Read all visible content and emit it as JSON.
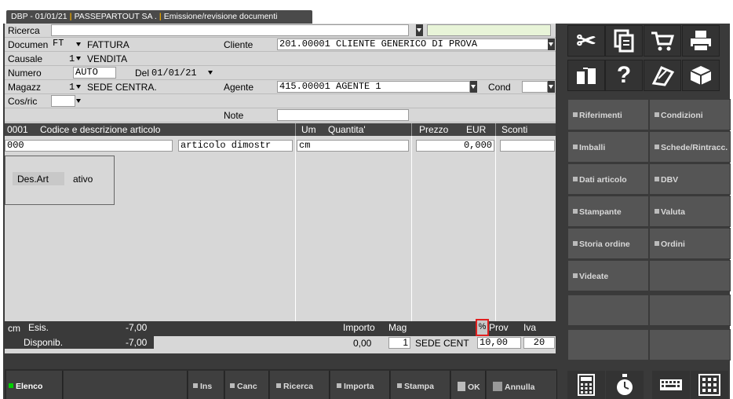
{
  "title_tab": {
    "part1": "DBP - 01/01/21",
    "part2": "PASSEPARTOUT SA .",
    "part3": "Emissione/revisione documenti"
  },
  "form": {
    "ricerca_label": "Ricerca",
    "documento_label": "Documen",
    "documento_code": "FT",
    "documento_desc": "FATTURA",
    "cliente_label": "Cliente",
    "cliente_value": "201.00001 CLIENTE GENERICO DI PROVA",
    "causale_label": "Causale",
    "causale_code": "1",
    "causale_desc": "VENDITA",
    "numero_label": "Numero",
    "numero_value": "AUTO",
    "del_label": "Del",
    "del_value": "01/01/21",
    "magazz_label": "Magazz",
    "magazz_code": "1",
    "magazz_desc": "SEDE CENTRA.",
    "agente_label": "Agente",
    "agente_value": "415.00001 AGENTE 1",
    "cond_label": "Cond",
    "cosric_label": "Cos/ric",
    "note_label": "Note"
  },
  "grid": {
    "headers": {
      "code": "0001",
      "desc": "Codice e descrizione articolo",
      "um": "Um",
      "qty": "Quantita'",
      "price": "Prezzo",
      "currency": "EUR",
      "discounts": "Sconti"
    },
    "row": {
      "code": "000",
      "desc": "articolo dimostr",
      "um": "cm",
      "price": "0,000"
    }
  },
  "popup": {
    "label": "Des.Art",
    "value": "ativo"
  },
  "status": {
    "um": "cm",
    "esis_label": "Esis.",
    "esis_value": "-7,00",
    "importo_label": "Importo",
    "mag_label": "Mag",
    "percent": "%",
    "prov_label": "Prov",
    "iva_label": "Iva",
    "disp_label": "Disponib.",
    "disp_value": "-7,00",
    "importo_value": "0,00",
    "mag_value": "1",
    "mag_desc": "SEDE CENT",
    "prov_value": "10,00",
    "iva_value": "20"
  },
  "toolbar": {
    "elenco": "Elenco",
    "ins": "Ins",
    "canc": "Canc",
    "ricerca": "Ricerca",
    "importa": "Importa",
    "stampa": "Stampa",
    "ok": "OK",
    "annulla": "Annulla"
  },
  "side_buttons": {
    "riferimenti": "Riferimenti",
    "condizioni": "Condizioni",
    "imballi": "Imballi",
    "schede": "Schede/Rintracc.",
    "dati_articolo": "Dati articolo",
    "dbv": "DBV",
    "stampante": "Stampante",
    "valuta": "Valuta",
    "storia_ordine": "Storia ordine",
    "ordini": "Ordini",
    "videate": "Videate"
  },
  "icons": {
    "top_row": [
      "scissors-icon",
      "copy-document-icon",
      "shopping-cart-icon",
      "printer-icon"
    ],
    "second_row": [
      "split-screen-icon",
      "help-icon",
      "edit-pencil-icon",
      "package-box-icon"
    ],
    "bottom_row": [
      "calculator-icon",
      "stopwatch-icon",
      "keyboard-icon",
      "grid-apps-icon"
    ]
  },
  "colors": {
    "frame": "#3a3a3a",
    "form_bg": "#d7d7d7",
    "highlight": "#e02020",
    "accent_green": "#00d000",
    "title_separator": "#e0a000"
  }
}
